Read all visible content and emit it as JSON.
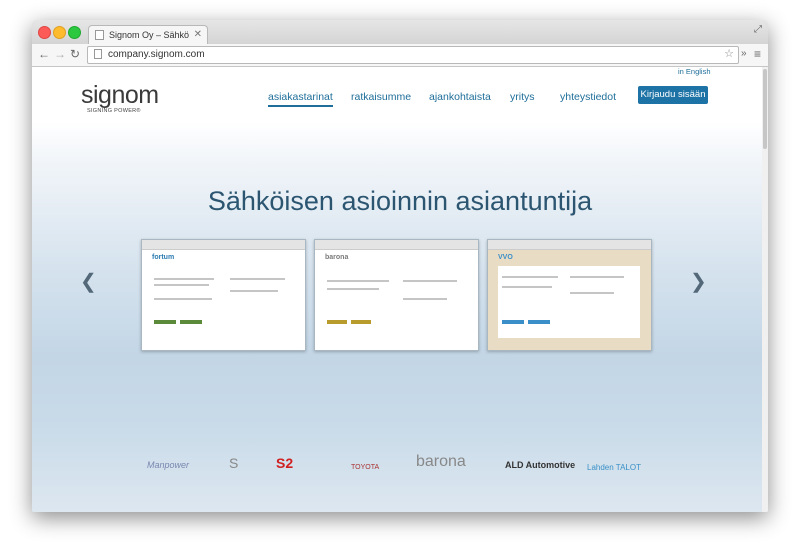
{
  "browser": {
    "tab_title": "Signom Oy – Sähköisen as",
    "tab_close": "✕",
    "url": "company.signom.com",
    "back_icon": "arrow-left-icon",
    "forward_icon": "arrow-right-icon",
    "reload_icon": "reload-icon",
    "star_icon": "star-icon",
    "menu_icon": "hamburger-menu-icon"
  },
  "site": {
    "logo_text": "signom",
    "logo_tagline": "SIGNING POWER®",
    "lang_link": "in English",
    "nav": [
      {
        "label": "asiakastarinat",
        "active": true
      },
      {
        "label": "ratkaisumme",
        "active": false
      },
      {
        "label": "ajankohtaista",
        "active": false
      },
      {
        "label": "yritys",
        "active": false
      },
      {
        "label": "yhteystiedot",
        "active": false
      }
    ],
    "login_label": "Kirjaudu sisään",
    "hero_title": "Sähköisen asioinnin asiantuntija",
    "carousel": {
      "prev_icon": "chevron-left-icon",
      "next_icon": "chevron-right-icon",
      "slides": [
        {
          "brand": "fortum",
          "brand_color": "#2a7ab0"
        },
        {
          "brand": "barona",
          "brand_color": "#7a7a7a"
        },
        {
          "brand": "VVO",
          "brand_color": "#3a8fc8"
        }
      ]
    },
    "clients": [
      "Manpower",
      "S",
      "S2",
      "TOYOTA",
      "barona",
      "ALD Automotive",
      "Lahden TALOT"
    ]
  },
  "colors": {
    "accent": "#1e6e99",
    "button": "#1e73a6",
    "hero_text": "#2b5570"
  }
}
